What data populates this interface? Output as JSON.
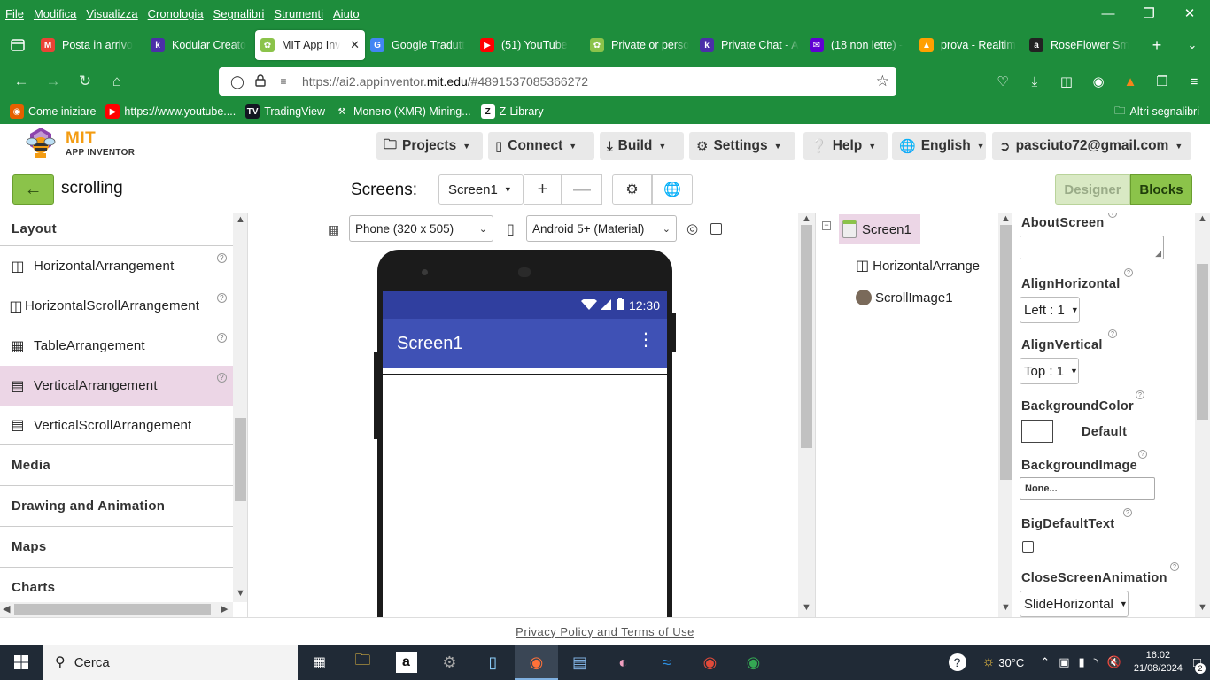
{
  "browser": {
    "menu": [
      "File",
      "Modifica",
      "Visualizza",
      "Cronologia",
      "Segnalibri",
      "Strumenti",
      "Aiuto"
    ],
    "tabs": [
      {
        "label": "Posta in arrivo",
        "icon": "gmail-icon",
        "color": "#ea4335",
        "glyph": "M"
      },
      {
        "label": "Kodular Creato",
        "icon": "kodular-icon",
        "color": "#4b2fa8",
        "glyph": "k"
      },
      {
        "label": "MIT App Inv",
        "icon": "app-inventor-icon",
        "color": "#8bc34a",
        "glyph": "✿",
        "active": true
      },
      {
        "label": "Google Tradutt",
        "icon": "google-translate-icon",
        "color": "#4285f4",
        "glyph": "G"
      },
      {
        "label": "(51) YouTube",
        "icon": "youtube-icon",
        "color": "#ff0000",
        "glyph": "▶"
      },
      {
        "label": "Private or perso",
        "icon": "app-inventor-icon",
        "color": "#8bc34a",
        "glyph": "✿"
      },
      {
        "label": "Private Chat - A",
        "icon": "kodular-icon",
        "color": "#4b2fa8",
        "glyph": "k"
      },
      {
        "label": "(18 non lette) -",
        "icon": "yahoo-mail-icon",
        "color": "#6001d2",
        "glyph": "✉"
      },
      {
        "label": "prova - Realtim",
        "icon": "firebase-icon",
        "color": "#ffa000",
        "glyph": "▲"
      },
      {
        "label": "RoseFlower Sm",
        "icon": "amazon-icon",
        "color": "#222222",
        "glyph": "a"
      }
    ],
    "url_prefix": "https://ai2.appinventor.",
    "url_domain": "mit.edu",
    "url_suffix": "/#4891537085366272",
    "bookmarks": [
      {
        "label": "Come iniziare",
        "icon": "firefox-icon",
        "color": "#e66000",
        "glyph": "◉"
      },
      {
        "label": "https://www.youtube....",
        "icon": "youtube-icon",
        "color": "#ff0000",
        "glyph": "▶"
      },
      {
        "label": "TradingView",
        "icon": "tradingview-icon",
        "color": "#131722",
        "glyph": "TV"
      },
      {
        "label": "Monero (XMR) Mining...",
        "icon": "pickaxe-icon",
        "color": "#1e8d3c",
        "glyph": "⚒"
      },
      {
        "label": "Z-Library",
        "icon": "z-library-icon",
        "color": "#ffffff",
        "glyph": "Z"
      }
    ],
    "other_bookmarks": "Altri segnalibri"
  },
  "app": {
    "logo": {
      "mit": "MIT",
      "sub": "APP INVENTOR"
    },
    "menus": [
      {
        "label": "Projects",
        "icon": "folder-icon"
      },
      {
        "label": "Connect",
        "icon": "phone-icon"
      },
      {
        "label": "Build",
        "icon": "download-icon"
      },
      {
        "label": "Settings",
        "icon": "gear-icon"
      },
      {
        "label": "Help",
        "icon": "help-icon"
      },
      {
        "label": "English",
        "icon": "globe-icon"
      },
      {
        "label": "pasciuto72@gmail.com",
        "icon": "sign-out-icon"
      }
    ],
    "project_name": "scrolling",
    "screens_label": "Screens:",
    "current_screen": "Screen1",
    "designer_label": "Designer",
    "blocks_label": "Blocks"
  },
  "palette": {
    "category_layout": "Layout",
    "items": [
      {
        "label": "HorizontalArrangement",
        "icon": "horizontal-arrangement-icon"
      },
      {
        "label": "HorizontalScrollArrangement",
        "icon": "horizontal-scroll-arrangement-icon"
      },
      {
        "label": "TableArrangement",
        "icon": "table-arrangement-icon"
      },
      {
        "label": "VerticalArrangement",
        "icon": "vertical-arrangement-icon",
        "selected": true
      },
      {
        "label": "VerticalScrollArrangement",
        "icon": "vertical-scroll-arrangement-icon"
      }
    ],
    "categories": [
      "Media",
      "Drawing and Animation",
      "Maps",
      "Charts"
    ]
  },
  "viewer": {
    "device_size": "Phone (320 x 505)",
    "theme": "Android 5+ (Material)",
    "phone_time": "12:30",
    "screen_title": "Screen1"
  },
  "components": {
    "root": "Screen1",
    "children": [
      {
        "label": "HorizontalArrange",
        "icon": "horizontal-arrangement-icon"
      },
      {
        "label": "ScrollImage1",
        "icon": "image-icon"
      }
    ]
  },
  "properties": {
    "about_screen": "AboutScreen",
    "align_horizontal": "AlignHorizontal",
    "align_horizontal_value": "Left : 1",
    "align_vertical": "AlignVertical",
    "align_vertical_value": "Top : 1",
    "background_color": "BackgroundColor",
    "background_color_value": "Default",
    "background_image": "BackgroundImage",
    "background_image_value": "None...",
    "big_default_text": "BigDefaultText",
    "close_screen_animation": "CloseScreenAnimation",
    "close_screen_animation_value": "SlideHorizontal"
  },
  "footer": {
    "link": "Privacy Policy and Terms of Use"
  },
  "taskbar": {
    "search_placeholder": "Cerca",
    "weather": "30°C",
    "time": "16:02",
    "date": "21/08/2024",
    "notifications": "2"
  },
  "colors": {
    "browser_green": "#1e8d3c",
    "ai_green": "#8bc34a",
    "selection_pink": "#ecd6e6",
    "material_indigo": "#3f51b5"
  }
}
